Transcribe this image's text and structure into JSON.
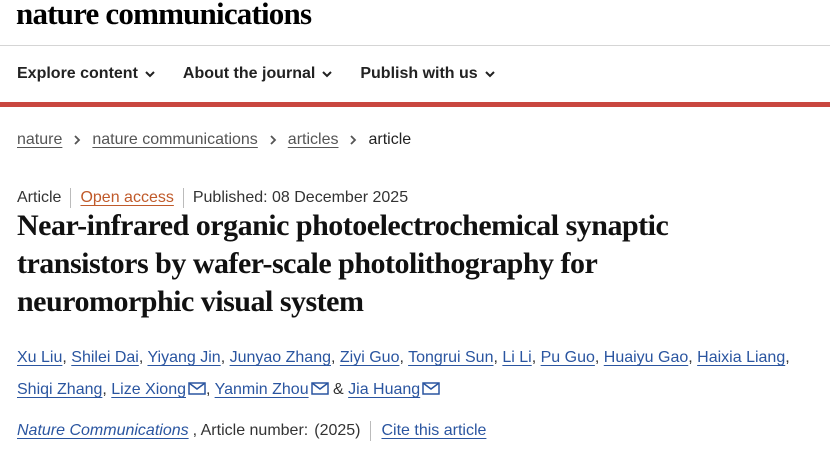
{
  "brand": "nature communications",
  "nav": [
    {
      "label": "Explore content"
    },
    {
      "label": "About the journal"
    },
    {
      "label": "Publish with us"
    }
  ],
  "breadcrumb": {
    "items": [
      "nature",
      "nature communications",
      "articles"
    ],
    "current": "article"
  },
  "meta": {
    "type": "Article",
    "access": "Open access",
    "published": "Published: 08 December 2025"
  },
  "title_lines": [
    "Near-infrared organic photoelectrochemical synaptic",
    "transistors by wafer-scale photolithography for",
    "neuromorphic visual system"
  ],
  "authors": [
    "Xu Liu",
    "Shilei Dai",
    "Yiyang Jin",
    "Junyao Zhang",
    "Ziyi Guo",
    "Tongrui Sun",
    "Li Li",
    "Pu Guo",
    "Huaiyu Gao",
    "Haixia Liang",
    "Shiqi Zhang",
    "Lize Xiong",
    "Yanmin Zhou",
    "Jia Huang"
  ],
  "citation": {
    "journal": "Nature Communications",
    "article_number": ", Article number:",
    "year": "(2025)",
    "cite_link": "Cite this article"
  },
  "colors": {
    "accent_bar": "#c9473f",
    "link": "#2a55a0",
    "open_access": "#c05a2a"
  }
}
